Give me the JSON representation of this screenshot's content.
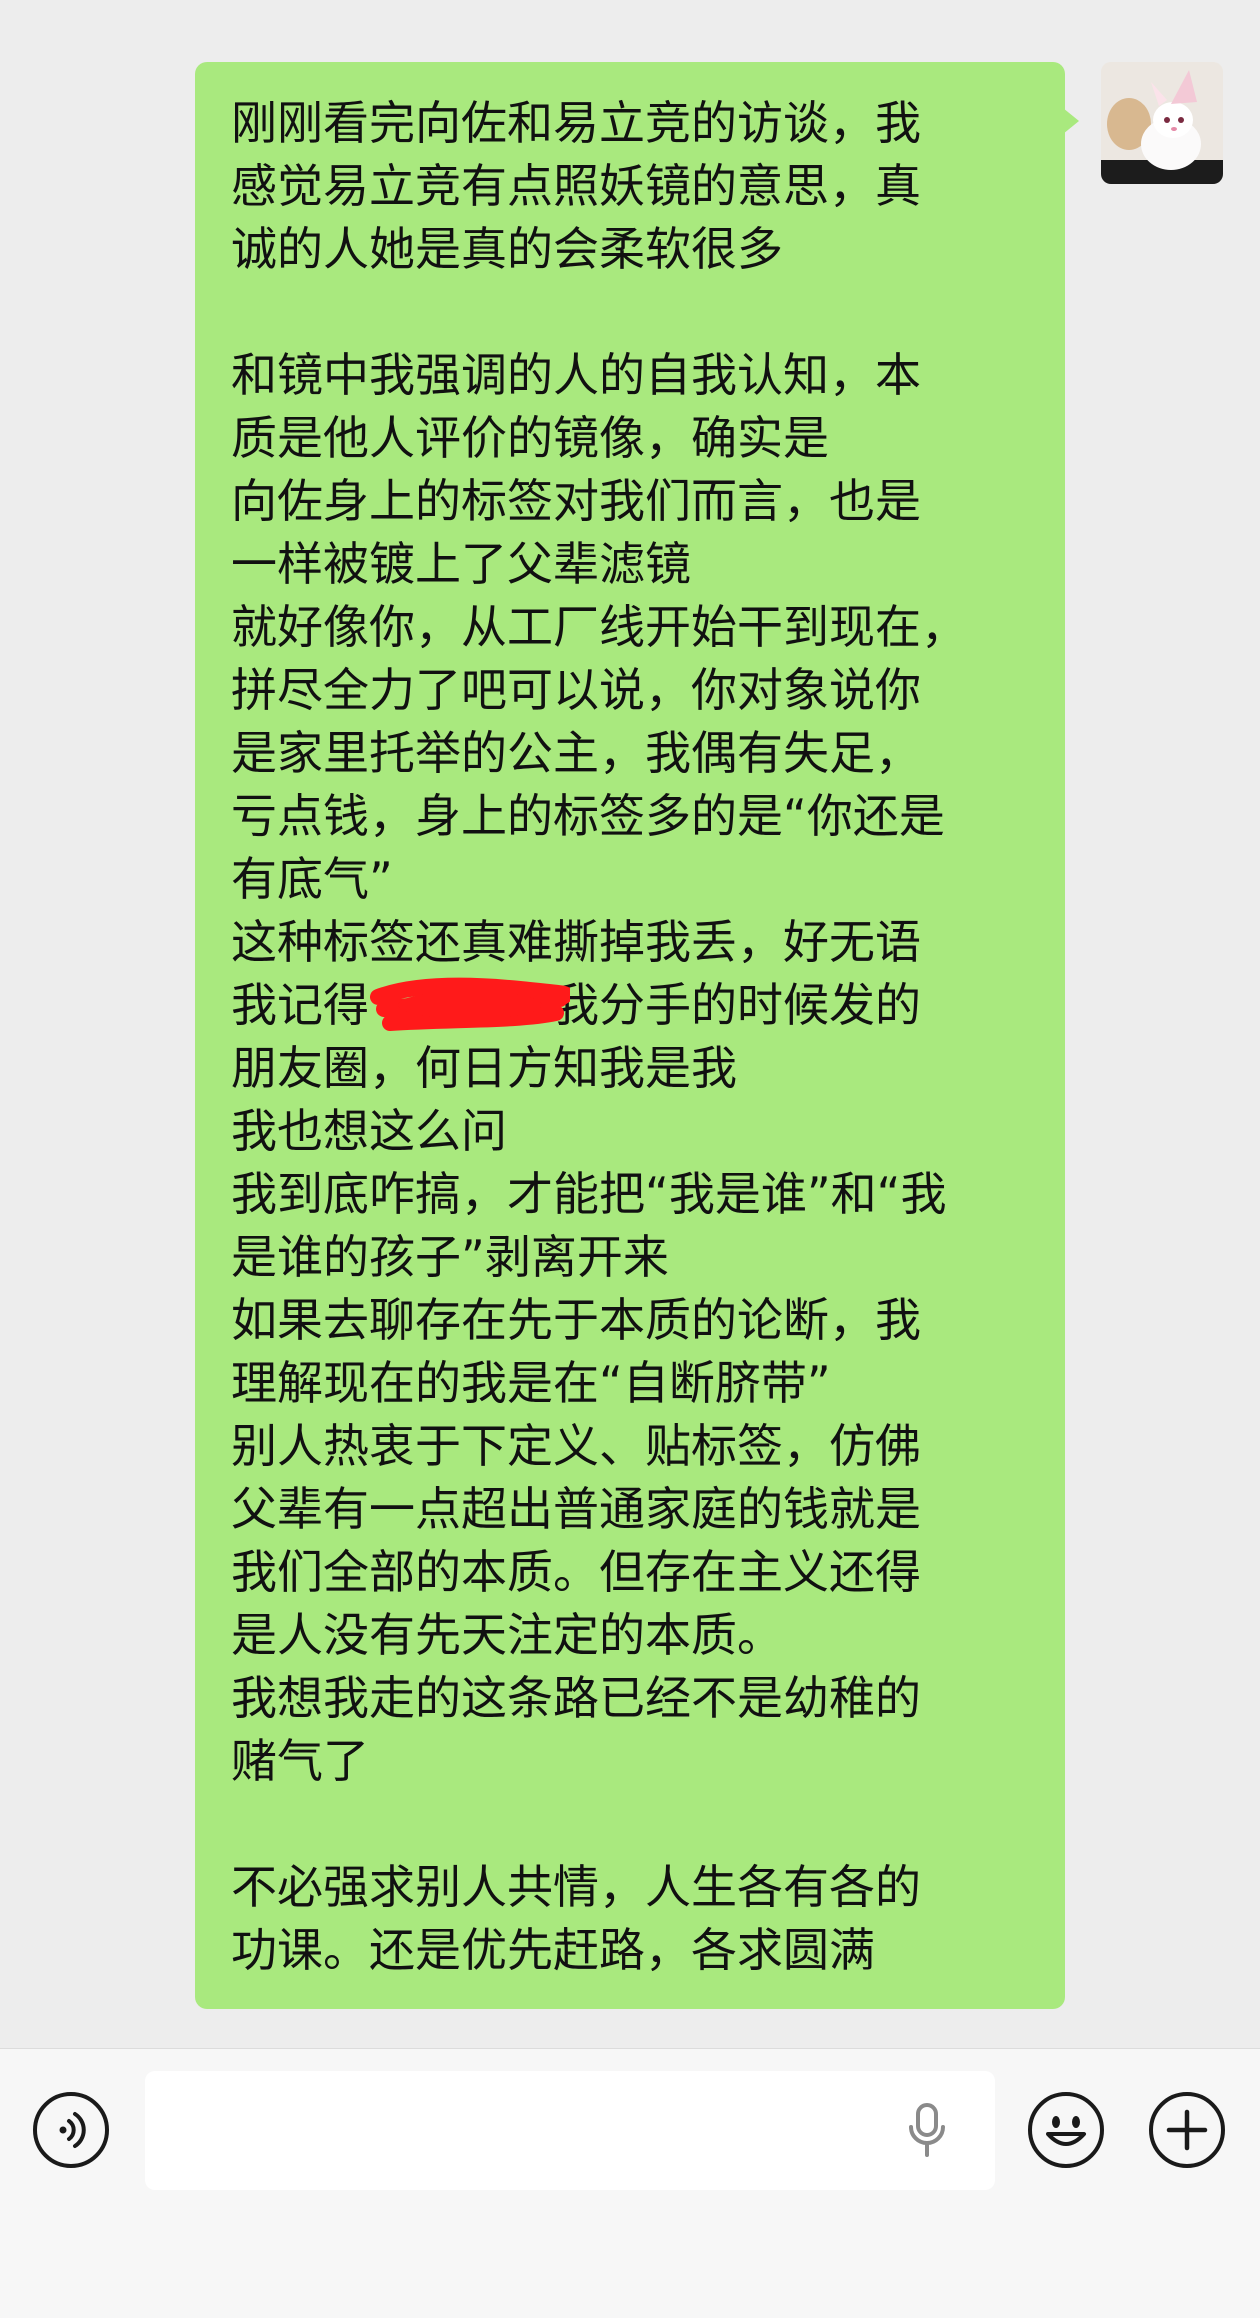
{
  "chat": {
    "message": {
      "lines": [
        "刚刚看完向佐和易立竞的访谈，我",
        "感觉易立竞有点照妖镜的意思，真",
        "诚的人她是真的会柔软很多",
        "",
        "和镜中我强调的人的自我认知，本",
        "质是他人评价的镜像，确实是",
        "向佐身上的标签对我们而言，也是",
        "一样被镀上了父辈滤镜",
        "就好像你，从工厂线开始干到现在，",
        "拼尽全力了吧可以说，你对象说你",
        "是家里托举的公主，我偶有失足，",
        "亏点钱，身上的标签多的是“你还是",
        "有底气”",
        "这种标签还真难撕掉我丢，好无语",
        "我记得　　　和我分手的时候发的",
        "朋友圈，何日方知我是我",
        "我也想这么问",
        "我到底咋搞，才能把“我是谁”和“我",
        "是谁的孩子”剥离开来",
        "如果去聊存在先于本质的论断，我",
        "理解现在的我是在“自断脐带”",
        "别人热衷于下定义、贴标签，仿佛",
        "父辈有一点超出普通家庭的钱就是",
        "我们全部的本质。但存在主义还得",
        "是人没有先天注定的本质。",
        "我想我走的这条路已经不是幼稚的",
        "赌气了",
        "",
        "不必强求别人共情，人生各有各的",
        "功课。还是优先赶路，各求圆满"
      ],
      "bubble_color": "#a9e97e",
      "redaction_color": "#ff1a1a"
    },
    "avatar": {
      "icon": "bunny-avatar-icon"
    }
  },
  "input_bar": {
    "voice_icon": "voice-mode-icon",
    "input_placeholder": "",
    "mic_icon": "microphone-icon",
    "emoji_icon": "emoji-icon",
    "plus_icon": "plus-icon"
  },
  "colors": {
    "background": "#ededed",
    "input_bar_bg": "#f7f7f7",
    "icon_stroke": "#1a1a1a"
  }
}
